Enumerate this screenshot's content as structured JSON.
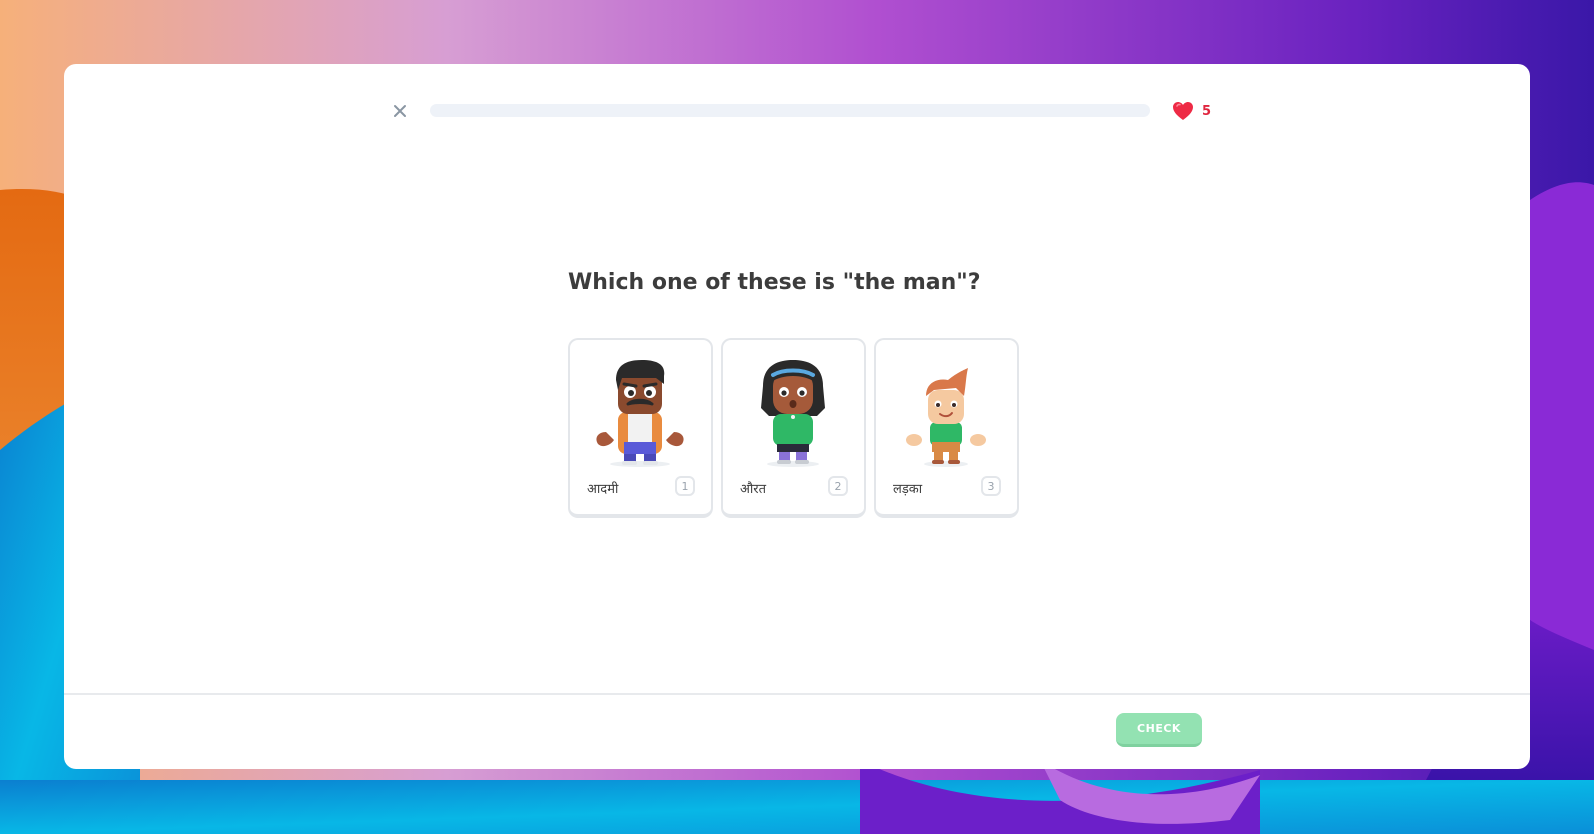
{
  "theme": {
    "accent_green": "#58cc02",
    "check_disabled": "#93e2b2",
    "heart_red": "#e0263f"
  },
  "header": {
    "close_icon": "close-icon",
    "progress_fraction": 0,
    "hearts": {
      "icon": "heart-icon",
      "count": "5"
    }
  },
  "challenge": {
    "prompt": "Which one of these is \"the man\"?",
    "choices": [
      {
        "label": "आदमी",
        "key": "1",
        "image": "man-character-icon"
      },
      {
        "label": "औरत",
        "key": "2",
        "image": "woman-character-icon"
      },
      {
        "label": "लड़का",
        "key": "3",
        "image": "boy-character-icon"
      }
    ]
  },
  "footer": {
    "check_label": "CHECK"
  }
}
